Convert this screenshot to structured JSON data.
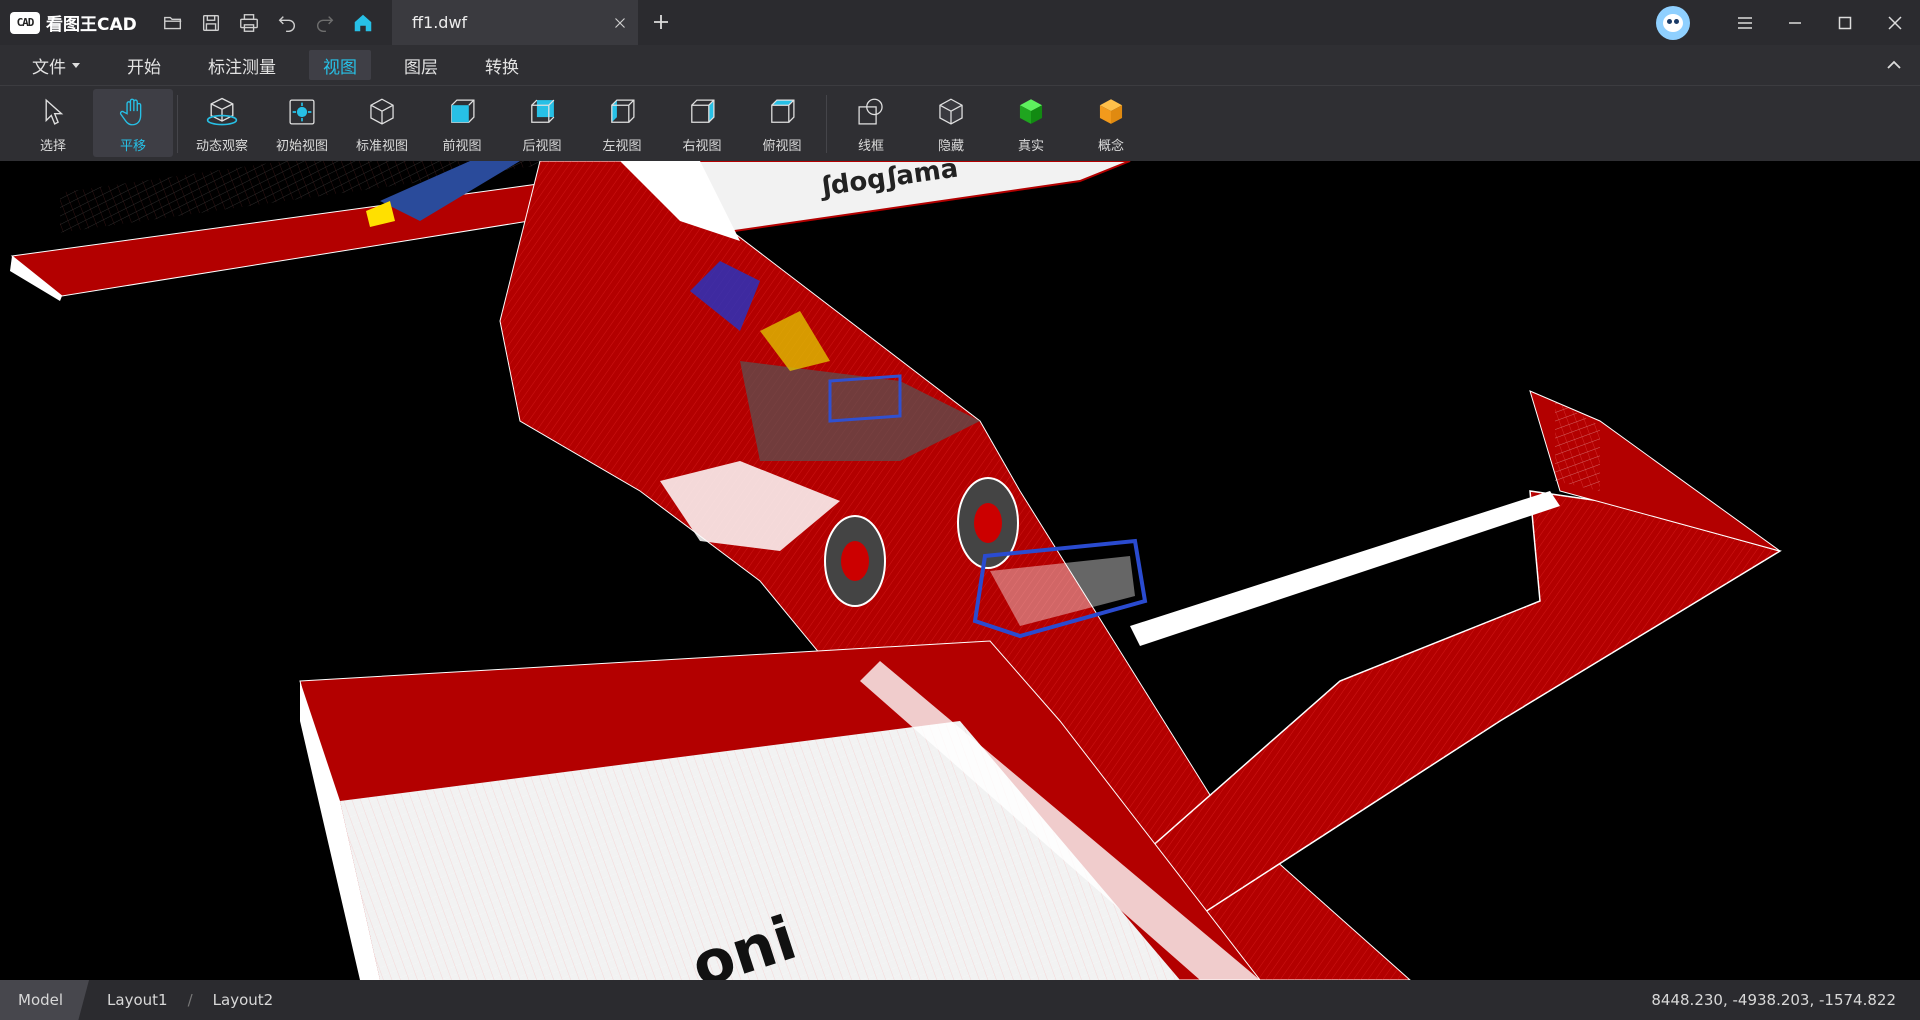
{
  "app": {
    "logo_badge": "CAD",
    "name": "看图王CAD"
  },
  "quick_access": [
    "open-folder-icon",
    "save-icon",
    "print-icon",
    "undo-icon",
    "redo-icon",
    "home-icon"
  ],
  "document_tab": {
    "label": "ff1.dwf"
  },
  "menu": {
    "items": [
      {
        "label": "文件",
        "has_dropdown": true
      },
      {
        "label": "开始"
      },
      {
        "label": "标注测量"
      },
      {
        "label": "视图",
        "active": true
      },
      {
        "label": "图层"
      },
      {
        "label": "转换"
      }
    ]
  },
  "toolbar": {
    "tools": [
      {
        "label": "选择",
        "icon": "cursor-arrow-icon"
      },
      {
        "label": "平移",
        "icon": "pan-hand-icon",
        "active": true
      },
      {
        "label": "动态观察",
        "icon": "orbit-icon"
      },
      {
        "label": "初始视图",
        "icon": "initial-view-icon"
      },
      {
        "label": "标准视图",
        "icon": "standard-view-icon"
      },
      {
        "label": "前视图",
        "icon": "front-view-icon"
      },
      {
        "label": "后视图",
        "icon": "back-view-icon"
      },
      {
        "label": "左视图",
        "icon": "left-view-icon"
      },
      {
        "label": "右视图",
        "icon": "right-view-icon"
      },
      {
        "label": "俯视图",
        "icon": "top-view-icon"
      },
      {
        "label": "线框",
        "icon": "wireframe-icon"
      },
      {
        "label": "隐藏",
        "icon": "hidden-icon"
      },
      {
        "label": "真实",
        "icon": "realistic-icon"
      },
      {
        "label": "概念",
        "icon": "conceptual-icon"
      }
    ]
  },
  "status": {
    "layouts": [
      "Model",
      "Layout1",
      "Layout2"
    ],
    "active_layout": "Model",
    "coordinates": "8448.230, -4938.203, -1574.822"
  },
  "colors": {
    "accent": "#27c0e6",
    "model_red": "#b30000",
    "canvas_bg": "#000000"
  }
}
